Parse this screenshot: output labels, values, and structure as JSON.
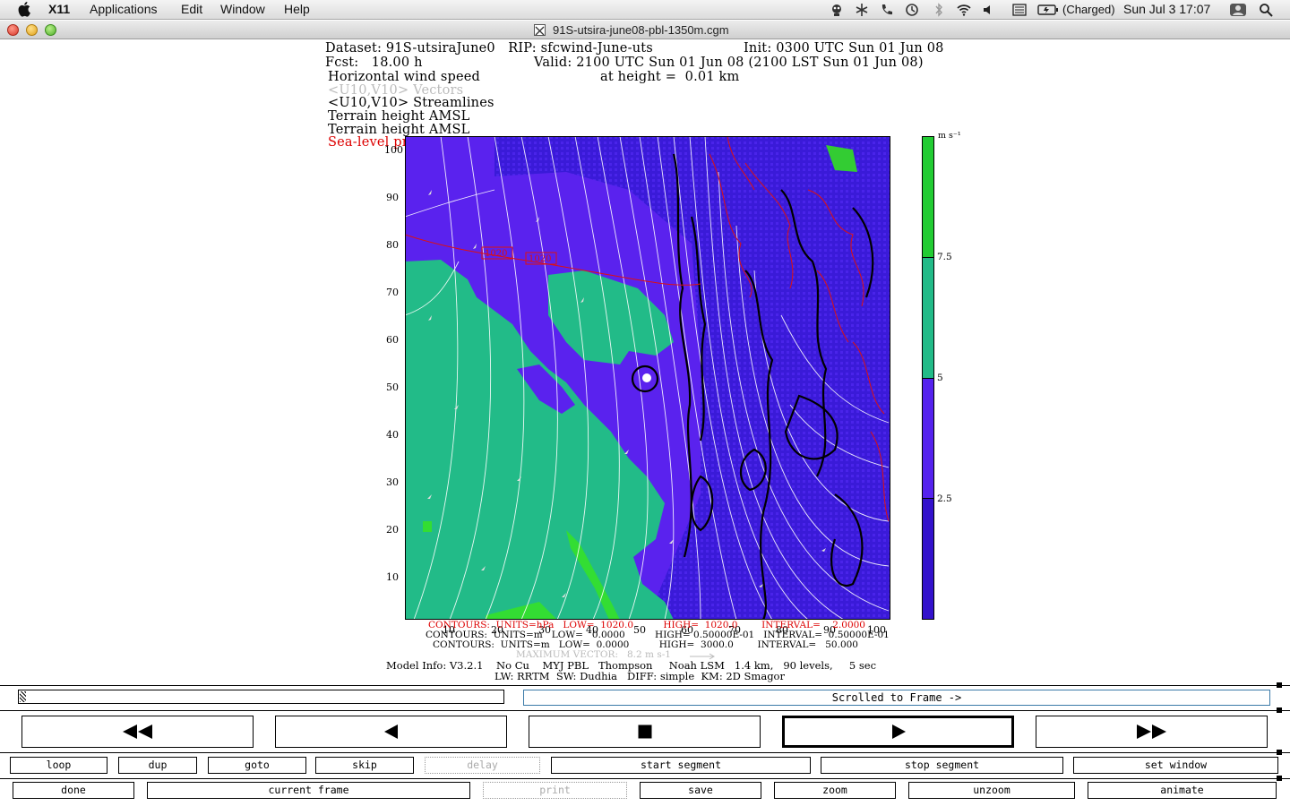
{
  "menubar": {
    "app": "X11",
    "items": [
      "Applications",
      "Edit",
      "Window",
      "Help"
    ],
    "battery": "(Charged)",
    "datetime": "Sun Jul 3  17:07"
  },
  "window": {
    "title": "91S-utsira-june08-pbl-1350m.cgm"
  },
  "plot": {
    "header": {
      "dataset": "Dataset: 91S-utsiraJune0   RIP: sfcwind-June-uts",
      "init": "Init: 0300 UTC Sun 01 Jun 08",
      "fcst": "Fcst:   18.00 h",
      "valid": "Valid: 2100 UTC Sun 01 Jun 08 (2100 LST Sun 01 Jun 08)",
      "field1": "Horizontal wind speed",
      "height": "at height =  0.01 km",
      "field2": "<U10,V10> Vectors",
      "field3": "<U10,V10> Streamlines",
      "field4": "Terrain height AMSL",
      "field5": "Terrain height AMSL",
      "field6": "Sea-level pressure"
    },
    "y_ticks": [
      "100",
      "90",
      "80",
      "70",
      "60",
      "50",
      "40",
      "30",
      "20",
      "10"
    ],
    "x_ticks": [
      "10",
      "20",
      "30",
      "40",
      "50",
      "60",
      "70",
      "80",
      "90",
      "100"
    ],
    "isobar_labels": [
      "1020",
      "1020"
    ],
    "colorbar": {
      "units": "m s⁻¹",
      "labels": [
        "7.5",
        "5",
        "2.5"
      ],
      "colors": [
        "#22cc33",
        "#22bb88",
        "#5522ee",
        "#3311cc"
      ]
    },
    "footer": {
      "c1": "CONTOURS:  UNITS=hPa   LOW=  1020.0          HIGH=  1020.0        INTERVAL=    2.0000",
      "c2": "CONTOURS:  UNITS=m   LOW=   0.0000          HIGH= 0.50000E-01   INTERVAL=  0.50000E-01",
      "c3": "CONTOURS:  UNITS=m   LOW=  0.0000          HIGH=  3000.0        INTERVAL=   50.000",
      "maxvec": "MAXIMUM VECTOR:   8.2 m s-1",
      "model1": "Model Info: V3.2.1    No Cu    MYJ PBL   Thompson     Noah LSM   1.4 km,   90 levels,     5 sec",
      "model2": "LW: RRTM  SW: Dudhia   DIFF: simple  KM: 2D Smagor"
    }
  },
  "controls": {
    "frame_status": "Scrolled to Frame ->",
    "row1": [
      "loop",
      "dup",
      "goto",
      "skip",
      "delay",
      "start segment",
      "stop segment",
      "set window"
    ],
    "row2": [
      "done",
      "current frame",
      "print",
      "save",
      "zoom",
      "unzoom",
      "animate"
    ]
  }
}
